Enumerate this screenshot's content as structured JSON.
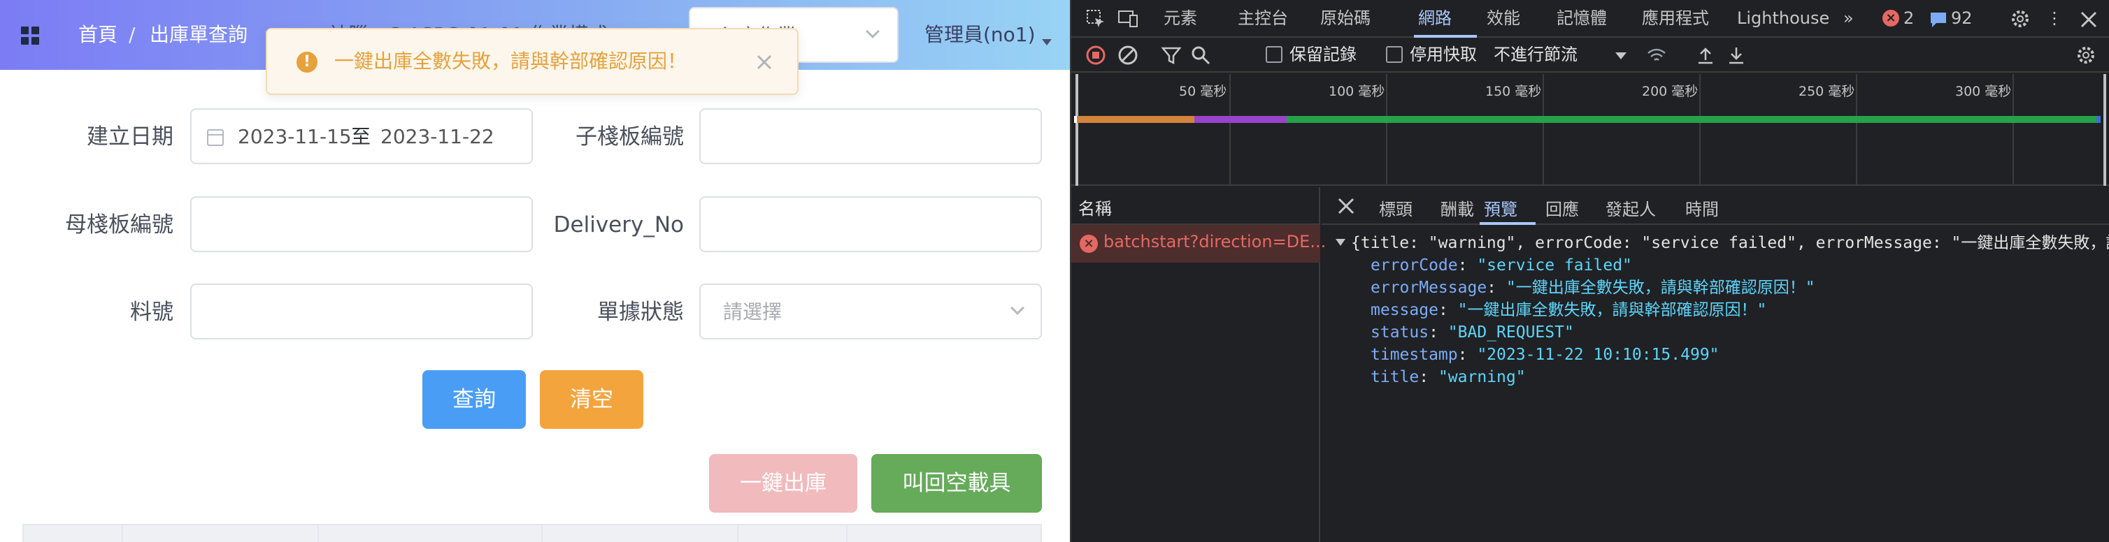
{
  "app": {
    "breadcrumb": {
      "home": "首頁",
      "separator": "/",
      "current": "出庫單查詢"
    },
    "faded_header_text": "神腦 - C-ASRS-01-01   作業模式",
    "mode_select": {
      "value": "入庫作業"
    },
    "user": "管理員(no1)",
    "toast": {
      "message": "一鍵出庫全數失敗，請與幹部確認原因！"
    },
    "form": {
      "created_date_label": "建立日期",
      "date_start": "2023-11-15",
      "date_to": "至",
      "date_end": "2023-11-22",
      "sub_pallet_label": "子棧板編號",
      "parent_pallet_label": "母棧板編號",
      "delivery_no_label": "Delivery_No",
      "part_no_label": "料號",
      "doc_status_label": "單據狀態",
      "doc_status_placeholder": "請選擇"
    },
    "buttons": {
      "query": "查詢",
      "clear": "清空",
      "one_click_outbound": "一鍵出庫",
      "recall_empty_carrier": "叫回空載具"
    }
  },
  "devtools": {
    "tabs": [
      "元素",
      "主控台",
      "原始碼",
      "網路",
      "效能",
      "記憶體",
      "應用程式",
      "Lighthouse"
    ],
    "active_tab": "網路",
    "error_count": "2",
    "message_count": "92",
    "toolbar": {
      "preserve_log": "保留記錄",
      "disable_cache": "停用快取",
      "throttling": "不進行節流"
    },
    "timeline_ticks": [
      "50 毫秒",
      "100 毫秒",
      "150 毫秒",
      "200 毫秒",
      "250 毫秒",
      "300 毫秒"
    ],
    "name_column": "名稱",
    "request_name": "batchstart?direction=DE...",
    "detail_tabs": [
      "標頭",
      "酬載",
      "預覽",
      "回應",
      "發起人",
      "時間"
    ],
    "active_detail_tab": "預覽",
    "preview": {
      "summary": "{title: \"warning\", errorCode: \"service failed\", errorMessage: \"一鍵出庫全數失敗，請與幹",
      "fields": [
        {
          "key": "errorCode",
          "value": "\"service failed\""
        },
        {
          "key": "errorMessage",
          "value": "\"一鍵出庫全數失敗，請與幹部確認原因！\""
        },
        {
          "key": "message",
          "value": "\"一鍵出庫全數失敗，請與幹部確認原因！\""
        },
        {
          "key": "status",
          "value": "\"BAD_REQUEST\""
        },
        {
          "key": "timestamp",
          "value": "\"2023-11-22 10:10:15.499\""
        },
        {
          "key": "title",
          "value": "\"warning\""
        }
      ]
    }
  }
}
